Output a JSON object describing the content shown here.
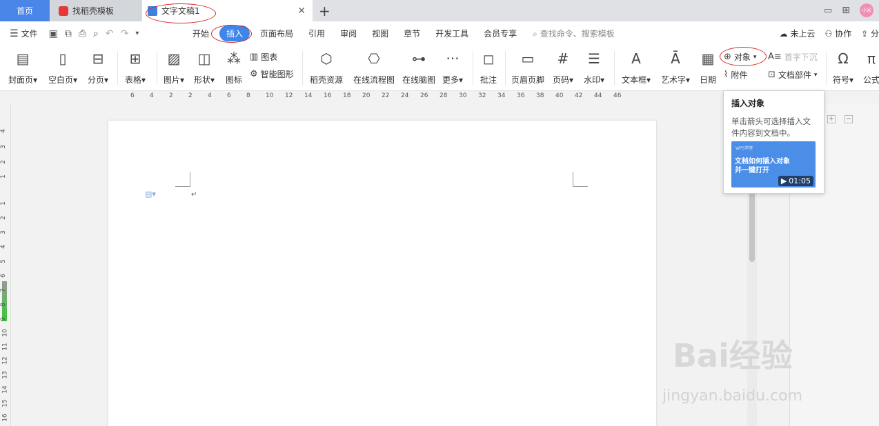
{
  "tabs": {
    "home": "首页",
    "template": "找稻壳模板",
    "doc": "文字文稿1"
  },
  "menu": {
    "file": "文件",
    "items": [
      "开始",
      "插入",
      "页面布局",
      "引用",
      "审阅",
      "视图",
      "章节",
      "开发工具",
      "会员专享"
    ],
    "search": "查找命令、搜索模板",
    "unsynced": "未上云",
    "collab": "协作",
    "share": "分"
  },
  "ribbon": {
    "cover": "封面页",
    "blank": "空白页",
    "pagebreak": "分页",
    "table": "表格",
    "picture": "图片",
    "shape": "形状",
    "icon": "图标",
    "chart": "图表",
    "smartart": "智能图形",
    "resource": "稻壳资源",
    "flowchart": "在线流程图",
    "mindmap": "在线脑图",
    "more": "更多",
    "comment": "批注",
    "headerfooter": "页眉页脚",
    "pagenum": "页码",
    "watermark": "水印",
    "textbox": "文本框",
    "wordart": "艺术字",
    "date": "日期",
    "object": "对象",
    "attachment": "附件",
    "dropcap": "首字下沉",
    "docparts": "文档部件",
    "symbol": "符号",
    "formula": "公式"
  },
  "ruler": {
    "h_ticks": [
      "6",
      "4",
      "2",
      "2",
      "4",
      "6",
      "8",
      "10",
      "12",
      "14",
      "16",
      "18",
      "20",
      "22",
      "24",
      "26",
      "28",
      "30",
      "32",
      "34",
      "36",
      "38",
      "40",
      "42",
      "44",
      "46"
    ],
    "v_ticks": [
      "4",
      "3",
      "2",
      "1",
      "1",
      "2",
      "3",
      "4",
      "5",
      "6",
      "7",
      "8",
      "9",
      "10",
      "11",
      "12",
      "13",
      "14",
      "15",
      "16"
    ]
  },
  "tooltip": {
    "title": "插入对象",
    "desc": "单击箭头可选择插入文件内容到文档中。",
    "video_brand": "WPS学堂",
    "video_text": "文档如何插入对象并一键打开",
    "duration": "01:05"
  },
  "watermark": {
    "main": "Bai经验",
    "sub": "jingyan.baidu.com"
  },
  "avatar": "小米",
  "colors": {
    "accent": "#3f86ea",
    "home_tab": "#4a86e8",
    "annotation": "#d62828"
  }
}
